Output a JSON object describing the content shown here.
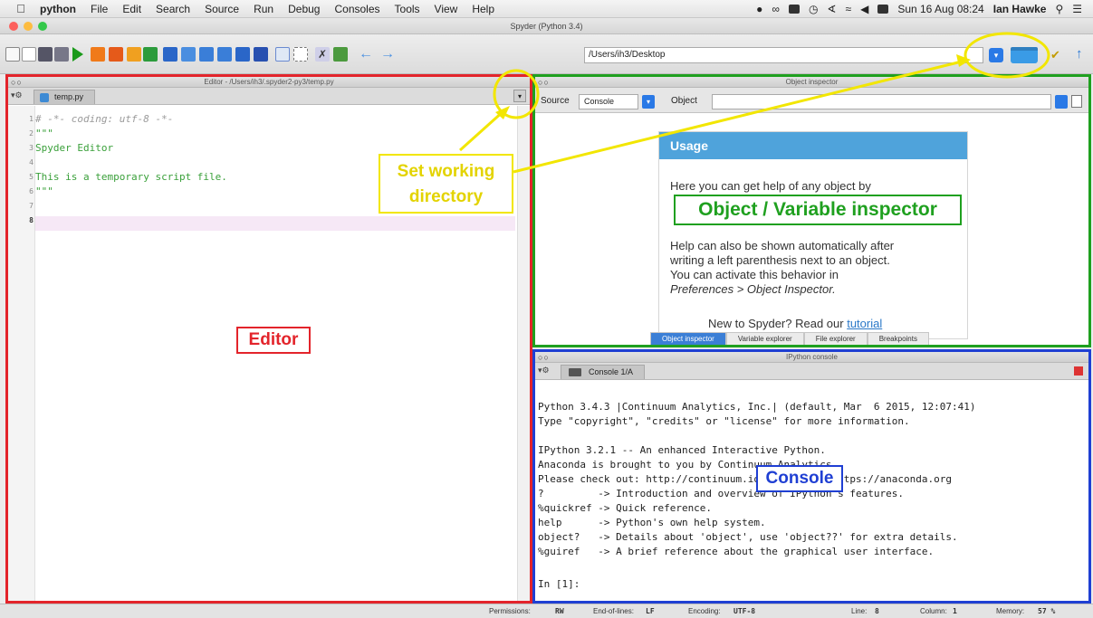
{
  "menubar": {
    "app_name": "python",
    "items": [
      "File",
      "Edit",
      "Search",
      "Source",
      "Run",
      "Debug",
      "Consoles",
      "Tools",
      "View",
      "Help"
    ],
    "clock": "Sun 16 Aug  08:24",
    "user": "Ian Hawke"
  },
  "window": {
    "title": "Spyder (Python 3.4)"
  },
  "toolbar": {
    "working_directory": "/Users/ih3/Desktop"
  },
  "editor": {
    "pane_title": "Editor - /Users/ih3/.spyder2-py3/temp.py",
    "tab": "temp.py",
    "line_numbers": [
      "1",
      "2",
      "3",
      "4",
      "5",
      "6",
      "7",
      "8"
    ],
    "lines": [
      "# -*- coding: utf-8 -*-",
      "\"\"\"",
      "Spyder Editor",
      "",
      "This is a temporary script file.",
      "\"\"\"",
      "",
      ""
    ],
    "annotation": "Editor"
  },
  "inspector": {
    "pane_title": "Object inspector",
    "source_label": "Source",
    "source_value": "Console",
    "object_label": "Object",
    "usage_title": "Usage",
    "usage_p1": "Here you can get help of any object by",
    "usage_p2a": "Help can also be shown automatically after",
    "usage_p2b": "writing a left parenthesis next to an object.",
    "usage_p2c": "You can activate this behavior in",
    "usage_p2d": "Preferences > Object Inspector.",
    "usage_p3_prefix": "New to Spyder? Read our ",
    "usage_p3_link": "tutorial",
    "tabs": [
      "Object inspector",
      "Variable explorer",
      "File explorer",
      "Breakpoints"
    ],
    "annotation": "Object / Variable inspector"
  },
  "console": {
    "pane_title": "IPython console",
    "tab": "Console 1/A",
    "lines": [
      "Python 3.4.3 |Continuum Analytics, Inc.| (default, Mar  6 2015, 12:07:41)",
      "Type \"copyright\", \"credits\" or \"license\" for more information.",
      "",
      "IPython 3.2.1 -- An enhanced Interactive Python.",
      "Anaconda is brought to you by Continuum Analytics.",
      "Please check out: http://continuum.io/thanks and https://anaconda.org",
      "?         -> Introduction and overview of IPython's features.",
      "%quickref -> Quick reference.",
      "help      -> Python's own help system.",
      "object?   -> Details about 'object', use 'object??' for extra details.",
      "%guiref   -> A brief reference about the graphical user interface.",
      "",
      "In [1]:"
    ],
    "annotation": "Console"
  },
  "callout": {
    "text_line1": "Set working",
    "text_line2": "directory"
  },
  "statusbar": {
    "permissions_label": "Permissions:",
    "permissions_value": "RW",
    "eol_label": "End-of-lines:",
    "eol_value": "LF",
    "encoding_label": "Encoding:",
    "encoding_value": "UTF-8",
    "line_label": "Line:",
    "line_value": "8",
    "column_label": "Column:",
    "column_value": "1",
    "memory_label": "Memory:",
    "memory_value": "57 %"
  },
  "colors": {
    "editor_frame": "#e3242b",
    "inspector_frame": "#1fa01f",
    "console_frame": "#1f3fd3",
    "callout": "#f2e600"
  }
}
